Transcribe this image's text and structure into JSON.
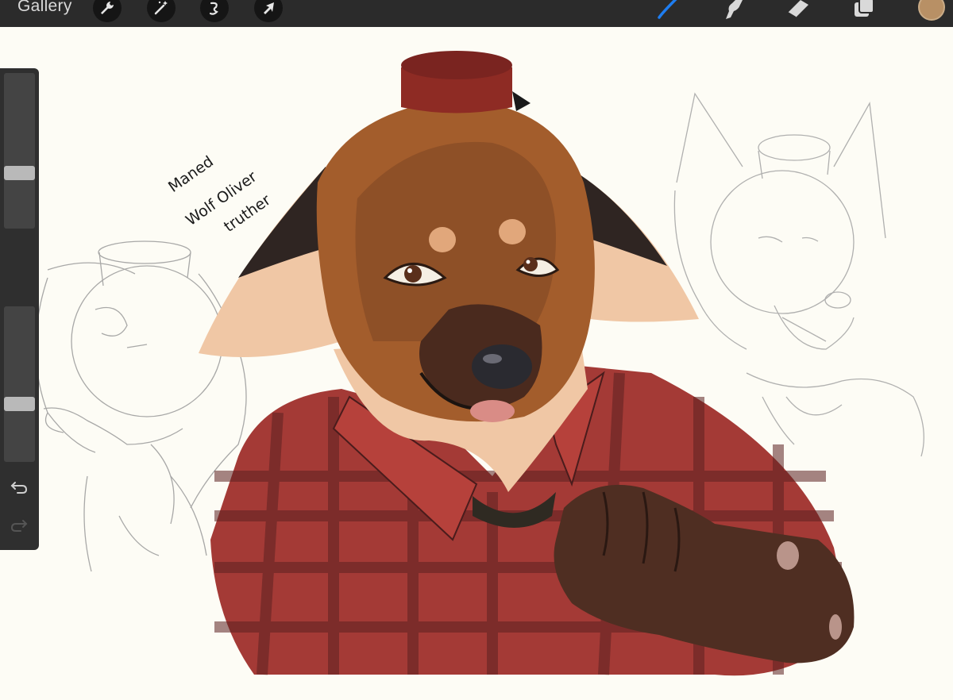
{
  "toolbar": {
    "gallery_label": "Gallery",
    "left_tools": [
      "wrench-icon",
      "magic-wand-icon",
      "selection-icon",
      "transform-arrow-icon"
    ],
    "right_tools": [
      "brush-icon",
      "smudge-icon",
      "eraser-icon",
      "layers-icon"
    ],
    "active_tool": "brush-icon",
    "active_color": "#b89065",
    "accent_color": "#1e7df0"
  },
  "sidebar": {
    "brush_size_level": 0.34,
    "opacity_level": 0.36,
    "items": [
      "brush-size-slider",
      "modify-button",
      "opacity-slider",
      "undo-icon",
      "redo-icon"
    ]
  },
  "canvas": {
    "caption_line1": "Maned",
    "caption_line2": "Wolf Oliver",
    "caption_line3": "truther",
    "background_color": "#fdfcf5"
  }
}
